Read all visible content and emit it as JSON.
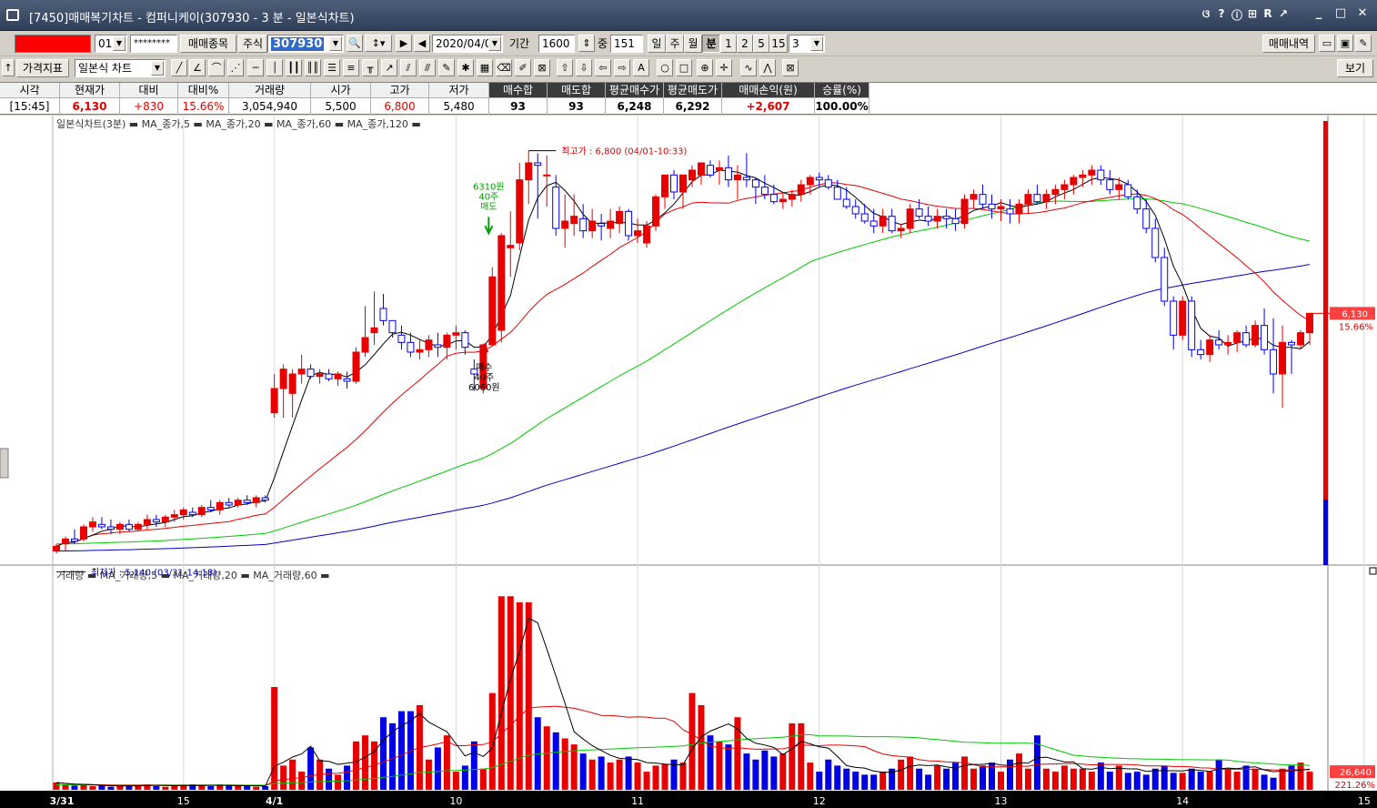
{
  "window": {
    "title": "[7450]매매복기차트 - 컴퍼니케이(307930 - 3 분 - 일본식차트)",
    "header_buttons": [
      "ଓ",
      "?",
      "ⓘ",
      "⊞",
      "R",
      "↗"
    ],
    "win_buttons": [
      "_",
      "□",
      "✕"
    ]
  },
  "toolbar1": {
    "account_masked": "",
    "account_suffix": "01",
    "password_mask": "********",
    "trade_items_button": "매매종목",
    "market_label": "주식",
    "stock_code": "307930",
    "date": "2020/04/01",
    "period_label": "기간",
    "period_value": "1600",
    "count_label": "중",
    "count_value": "151",
    "period_types": [
      "일",
      "주",
      "월",
      "분"
    ],
    "selected_period_type": "분",
    "minute_options": [
      "1",
      "2",
      "5",
      "15"
    ],
    "minute_value": "3",
    "trade_history_button": "매매내역"
  },
  "toolbar2": {
    "indicator_button": "가격지표",
    "chart_type": "일본식 차트",
    "view_button": "보기"
  },
  "info_table": {
    "headers": [
      "시각",
      "현재가",
      "대비",
      "대비%",
      "거래량",
      "시가",
      "고가",
      "저가",
      "매수합",
      "매도합",
      "평균매수가",
      "평균매도가",
      "매매손익(원)",
      "승률(%)"
    ],
    "values": [
      "[15:45]",
      "6,130",
      "+830",
      "15.66%",
      "3,054,940",
      "5,500",
      "6,800",
      "5,480",
      "93",
      "93",
      "6,248",
      "6,292",
      "+2,607",
      "100.00%"
    ]
  },
  "colors": {
    "up": "#e60000",
    "down": "#0000e6",
    "ma5": "#000000",
    "ma20": "#e60000",
    "ma60": "#00c800",
    "ma120": "#0000c8"
  },
  "price_chart": {
    "legend": "일본식차트(3분) ▬ MA_종가,5 ▬ MA_종가,20 ▬ MA_종가,60 ▬ MA_종가,120 ▬",
    "high_label": "최고가 : 6,800 (04/01-10:33)",
    "low_label": "최저가 : 5,140 (03/31-14:18)",
    "sell_marker": [
      "6310원",
      "40주",
      "매도"
    ],
    "buy_marker": [
      "매수",
      "40주",
      "6060원"
    ],
    "current_price_tag": "6,130",
    "current_pct_tag": "15.66%"
  },
  "volume_chart": {
    "legend": "거래량 ▬ MA_거래량,5 ▬ MA_거래량,20 ▬ MA_거래량,60 ▬",
    "current_volume_tag": "26,640",
    "current_pct_tag": "221.26%"
  },
  "x_axis_labels": [
    "3/31",
    "15",
    "4/1",
    "10",
    "11",
    "12",
    "13",
    "14",
    "15"
  ],
  "chart_data": {
    "type": "candlestick",
    "price_range": [
      5100,
      6900
    ],
    "candles": [
      [
        5150,
        5180,
        5140,
        5170
      ],
      [
        5180,
        5210,
        5150,
        5200
      ],
      [
        5200,
        5240,
        5180,
        5190
      ],
      [
        5200,
        5260,
        5190,
        5250
      ],
      [
        5250,
        5290,
        5230,
        5270
      ],
      [
        5260,
        5290,
        5240,
        5250
      ],
      [
        5250,
        5280,
        5220,
        5240
      ],
      [
        5240,
        5270,
        5220,
        5260
      ],
      [
        5260,
        5280,
        5230,
        5240
      ],
      [
        5240,
        5270,
        5230,
        5260
      ],
      [
        5260,
        5300,
        5240,
        5280
      ],
      [
        5280,
        5300,
        5250,
        5270
      ],
      [
        5270,
        5300,
        5250,
        5290
      ],
      [
        5290,
        5320,
        5270,
        5300
      ],
      [
        5300,
        5330,
        5280,
        5320
      ],
      [
        5310,
        5330,
        5290,
        5300
      ],
      [
        5300,
        5340,
        5290,
        5330
      ],
      [
        5330,
        5360,
        5310,
        5320
      ],
      [
        5320,
        5360,
        5300,
        5350
      ],
      [
        5350,
        5370,
        5330,
        5340
      ],
      [
        5340,
        5370,
        5330,
        5360
      ],
      [
        5360,
        5380,
        5340,
        5350
      ],
      [
        5350,
        5380,
        5330,
        5370
      ],
      [
        5370,
        5380,
        5350,
        5360
      ],
      [
        5720,
        5880,
        5700,
        5820
      ],
      [
        5820,
        5920,
        5700,
        5900
      ],
      [
        5800,
        5900,
        5700,
        5880
      ],
      [
        5880,
        5960,
        5840,
        5900
      ],
      [
        5900,
        5920,
        5860,
        5870
      ],
      [
        5870,
        5900,
        5840,
        5880
      ],
      [
        5880,
        5900,
        5850,
        5860
      ],
      [
        5860,
        5890,
        5830,
        5880
      ],
      [
        5860,
        5890,
        5820,
        5850
      ],
      [
        5850,
        5990,
        5840,
        5970
      ],
      [
        5970,
        6160,
        5950,
        6030
      ],
      [
        6050,
        6220,
        6000,
        6070
      ],
      [
        6150,
        6210,
        6080,
        6100
      ],
      [
        6100,
        6100,
        6030,
        6050
      ],
      [
        6040,
        6080,
        5980,
        6010
      ],
      [
        6010,
        6050,
        5950,
        5970
      ],
      [
        5970,
        6020,
        5940,
        5980
      ],
      [
        5980,
        6040,
        5950,
        6020
      ],
      [
        6000,
        6050,
        5950,
        5990
      ],
      [
        5990,
        6050,
        5940,
        6040
      ],
      [
        6040,
        6080,
        5980,
        6050
      ],
      [
        6050,
        6060,
        5960,
        5990
      ],
      [
        5900,
        5940,
        5810,
        5880
      ],
      [
        5820,
        6000,
        5800,
        6000
      ],
      [
        6000,
        6320,
        6000,
        6280
      ],
      [
        6060,
        6460,
        6010,
        6450
      ],
      [
        6400,
        6550,
        6280,
        6410
      ],
      [
        6420,
        6750,
        6390,
        6680
      ],
      [
        6680,
        6800,
        6580,
        6750
      ],
      [
        6750,
        6790,
        6520,
        6740
      ],
      [
        6700,
        6780,
        6570,
        6700
      ],
      [
        6650,
        6700,
        6450,
        6480
      ],
      [
        6480,
        6620,
        6400,
        6510
      ],
      [
        6500,
        6620,
        6450,
        6530
      ],
      [
        6520,
        6580,
        6440,
        6470
      ],
      [
        6470,
        6560,
        6440,
        6510
      ],
      [
        6500,
        6540,
        6430,
        6490
      ],
      [
        6480,
        6560,
        6440,
        6510
      ],
      [
        6500,
        6570,
        6460,
        6550
      ],
      [
        6550,
        6560,
        6430,
        6450
      ],
      [
        6450,
        6520,
        6420,
        6470
      ],
      [
        6420,
        6510,
        6400,
        6490
      ],
      [
        6490,
        6620,
        6470,
        6610
      ],
      [
        6610,
        6700,
        6560,
        6700
      ],
      [
        6700,
        6720,
        6600,
        6630
      ],
      [
        6630,
        6700,
        6560,
        6700
      ],
      [
        6680,
        6740,
        6650,
        6720
      ],
      [
        6700,
        6740,
        6660,
        6750
      ],
      [
        6740,
        6760,
        6690,
        6700
      ],
      [
        6720,
        6760,
        6660,
        6730
      ],
      [
        6730,
        6780,
        6650,
        6680
      ],
      [
        6680,
        6740,
        6600,
        6700
      ],
      [
        6690,
        6790,
        6650,
        6680
      ],
      [
        6680,
        6690,
        6580,
        6650
      ],
      [
        6650,
        6700,
        6600,
        6620
      ],
      [
        6620,
        6660,
        6580,
        6590
      ],
      [
        6590,
        6630,
        6560,
        6600
      ],
      [
        6600,
        6640,
        6570,
        6620
      ],
      [
        6620,
        6680,
        6590,
        6660
      ],
      [
        6660,
        6700,
        6620,
        6690
      ],
      [
        6690,
        6710,
        6650,
        6680
      ],
      [
        6680,
        6700,
        6640,
        6650
      ],
      [
        6650,
        6680,
        6620,
        6600
      ],
      [
        6600,
        6650,
        6560,
        6570
      ],
      [
        6570,
        6600,
        6520,
        6540
      ],
      [
        6540,
        6580,
        6500,
        6510
      ],
      [
        6510,
        6560,
        6460,
        6490
      ],
      [
        6490,
        6560,
        6460,
        6530
      ],
      [
        6530,
        6560,
        6460,
        6470
      ],
      [
        6470,
        6500,
        6440,
        6480
      ],
      [
        6480,
        6580,
        6460,
        6560
      ],
      [
        6560,
        6600,
        6520,
        6530
      ],
      [
        6530,
        6570,
        6490,
        6510
      ],
      [
        6510,
        6560,
        6480,
        6530
      ],
      [
        6530,
        6560,
        6480,
        6520
      ],
      [
        6520,
        6560,
        6470,
        6500
      ],
      [
        6500,
        6620,
        6480,
        6600
      ],
      [
        6600,
        6640,
        6560,
        6620
      ],
      [
        6620,
        6660,
        6560,
        6580
      ],
      [
        6580,
        6620,
        6520,
        6560
      ],
      [
        6560,
        6600,
        6510,
        6570
      ],
      [
        6560,
        6600,
        6500,
        6540
      ],
      [
        6540,
        6600,
        6500,
        6580
      ],
      [
        6580,
        6640,
        6540,
        6620
      ],
      [
        6620,
        6660,
        6580,
        6590
      ],
      [
        6590,
        6640,
        6560,
        6620
      ],
      [
        6620,
        6660,
        6580,
        6640
      ],
      [
        6640,
        6680,
        6600,
        6660
      ],
      [
        6660,
        6700,
        6620,
        6690
      ],
      [
        6690,
        6720,
        6650,
        6700
      ],
      [
        6700,
        6740,
        6660,
        6720
      ],
      [
        6720,
        6740,
        6660,
        6680
      ],
      [
        6680,
        6720,
        6620,
        6640
      ],
      [
        6640,
        6690,
        6600,
        6660
      ],
      [
        6660,
        6680,
        6600,
        6610
      ],
      [
        6610,
        6640,
        6540,
        6560
      ],
      [
        6560,
        6600,
        6460,
        6480
      ],
      [
        6480,
        6520,
        6340,
        6360
      ],
      [
        6360,
        6400,
        6160,
        6180
      ],
      [
        6180,
        6200,
        5980,
        6040
      ],
      [
        6040,
        6200,
        6020,
        6180
      ],
      [
        6180,
        6200,
        5950,
        5980
      ],
      [
        5980,
        6020,
        5940,
        5960
      ],
      [
        5960,
        6040,
        5930,
        6020
      ],
      [
        6020,
        6060,
        5980,
        6000
      ],
      [
        6000,
        6040,
        5960,
        6010
      ],
      [
        6010,
        6060,
        5970,
        6050
      ],
      [
        6050,
        6080,
        5990,
        6000
      ],
      [
        6000,
        6100,
        5990,
        6080
      ],
      [
        6080,
        6150,
        5960,
        5980
      ],
      [
        5980,
        6110,
        5800,
        5880
      ],
      [
        5880,
        6080,
        5740,
        6010
      ],
      [
        6010,
        6020,
        5880,
        6000
      ],
      [
        6000,
        6060,
        5980,
        6050
      ],
      [
        6050,
        6070,
        6000,
        6130
      ]
    ],
    "volumes": [
      1200,
      900,
      700,
      800,
      600,
      700,
      500,
      600,
      800,
      700,
      900,
      600,
      500,
      700,
      800,
      900,
      700,
      600,
      800,
      700,
      600,
      700,
      500,
      600,
      17000,
      4000,
      5000,
      3000,
      7000,
      5000,
      3500,
      2500,
      4000,
      8000,
      9000,
      8000,
      12000,
      11000,
      13000,
      13000,
      14000,
      5000,
      7000,
      9000,
      3000,
      4000,
      8000,
      3500,
      16000,
      32000,
      32000,
      31000,
      31000,
      12000,
      10500,
      9500,
      8500,
      7500,
      6000,
      5000,
      5500,
      4500,
      5000,
      5500,
      4500,
      3000,
      4000,
      4200,
      5000,
      4500,
      16000,
      14000,
      9000,
      8000,
      7500,
      12000,
      6000,
      5000,
      6500,
      5500,
      6000,
      11000,
      11000,
      4500,
      3000,
      5000,
      4000,
      3500,
      3000,
      2500,
      2500,
      3000,
      3500,
      5000,
      5500,
      3500,
      2500,
      4000,
      3500,
      4500,
      5500,
      3500,
      4000,
      4500,
      3000,
      5000,
      6000,
      3500,
      9000,
      3500,
      3000,
      4000,
      3500,
      3500,
      3000,
      4500,
      3000,
      4000,
      2800,
      3000,
      2500,
      3500,
      4000,
      2800,
      2800,
      3500,
      3000,
      3000,
      5000,
      3500,
      3000,
      4000,
      3500,
      2500,
      2000,
      3500,
      4000,
      4500,
      3000,
      3500,
      4000,
      5500,
      3500,
      12000,
      8000,
      10000,
      11000,
      9000,
      10000,
      11000,
      13000,
      10000,
      9000,
      8000,
      7000,
      6000,
      9000,
      5000,
      7000,
      12000,
      7000,
      12000,
      7000,
      9000
    ]
  }
}
